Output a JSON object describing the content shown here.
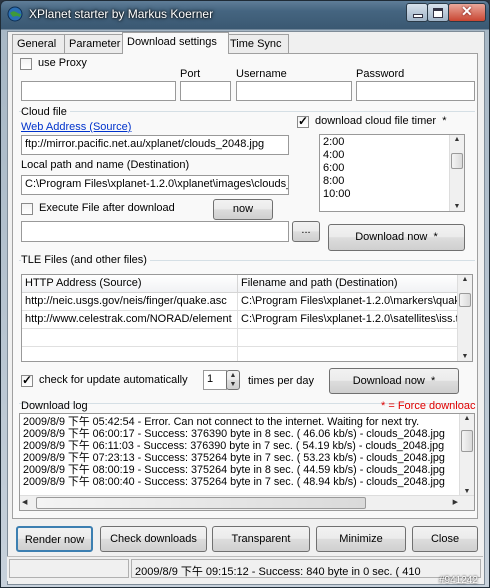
{
  "window": {
    "title": "XPlanet starter by Markus Koerner"
  },
  "tabs": [
    {
      "label": "General"
    },
    {
      "label": "Parameter"
    },
    {
      "label": "Download settings"
    },
    {
      "label": "Time Sync"
    }
  ],
  "proxy": {
    "use_proxy_label": "use Proxy",
    "port_label": "Port",
    "username_label": "Username",
    "password_label": "Password",
    "host_value": "",
    "port_value": "",
    "username_value": "",
    "password_value": ""
  },
  "cloud": {
    "group_label": "Cloud file",
    "web_address_label": "Web Address (Source)",
    "web_address_value": "ftp://mirror.pacific.net.au/xplanet/clouds_2048.jpg",
    "local_path_label": "Local path and name (Destination)",
    "local_path_value": "C:\\Program Files\\xplanet-1.2.0\\xplanet\\images\\clouds_",
    "execute_label": "Execute File after download",
    "now_button": "now",
    "browse_button": "...",
    "execute_path_value": "",
    "timer_label": "download cloud file timer",
    "timer_star": "*",
    "timer_times": [
      "2:00",
      "4:00",
      "6:00",
      "8:00",
      "10:00"
    ],
    "download_now_button": "Download now",
    "download_now_star": "*"
  },
  "tle": {
    "group_label": "TLE Files (and other files)",
    "columns": [
      "HTTP Address (Source)",
      "Filename and path (Destination)"
    ],
    "rows": [
      [
        "http://neic.usgs.gov/neis/finger/quake.asc",
        "C:\\Program Files\\xplanet-1.2.0\\markers\\quak"
      ],
      [
        "http://www.celestrak.com/NORAD/element",
        "C:\\Program Files\\xplanet-1.2.0\\satellites\\iss.t"
      ]
    ],
    "auto_check_label": "check for update automatically",
    "times_value": "1",
    "times_label": "times per day",
    "download_now_button": "Download now",
    "download_now_star": "*"
  },
  "log": {
    "label": "Download log",
    "force_note": "* = Force downloac",
    "lines": [
      "2009/8/9 下午 05:42:54 - Error. Can not connect to the internet. Waiting for next try.",
      "2009/8/9 下午 06:00:17 - Success: 376390 byte in   8 sec. (  46.06 kb/s) - clouds_2048.jpg",
      "2009/8/9 下午 06:11:03 - Success: 376390 byte in   7 sec. (  54.19 kb/s) - clouds_2048.jpg",
      "2009/8/9 下午 07:23:13 - Success: 375264 byte in   7 sec. (  53.23 kb/s) - clouds_2048.jpg",
      "2009/8/9 下午 08:00:19 - Success: 375264 byte in   8 sec. (  44.59 kb/s) - clouds_2048.jpg",
      "2009/8/9 下午 08:00:40 - Success: 375264 byte in   7 sec. (  48.94 kb/s) - clouds_2048.jpg"
    ]
  },
  "buttons": {
    "render_now": "Render now",
    "check_downloads": "Check downloads",
    "transparent": "Transparent",
    "minimize": "Minimize",
    "close": "Close"
  },
  "status": {
    "text": "2009/8/9 下午 09:15:12 - Success: 840 byte in    0 sec. ( 410"
  },
  "watermark": "#941242"
}
